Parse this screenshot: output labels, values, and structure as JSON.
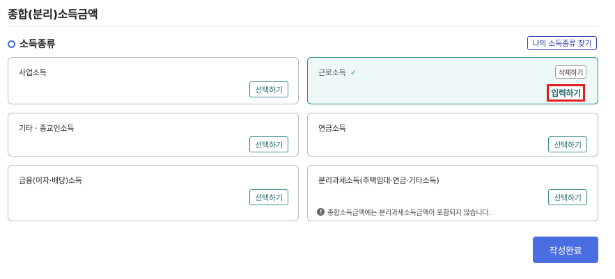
{
  "page_title": "종합(분리)소득금액",
  "section": {
    "title": "소득종류",
    "find_button": "나의 소득종류 찾기"
  },
  "cards": [
    {
      "label": "사업소득",
      "button": "선택하기"
    },
    {
      "label": "근로소득",
      "check": "✓",
      "delete_button": "삭제하기",
      "input_button": "입력하기",
      "selected": true
    },
    {
      "label": "기타 · 종교인소득",
      "button": "선택하기"
    },
    {
      "label": "연금소득",
      "button": "선택하기"
    },
    {
      "label": "금융(이자·배당)소득",
      "button": "선택하기"
    },
    {
      "label": "분리과세소득(주택임대·연금·기타소득)",
      "button": "선택하기",
      "note_icon": "!",
      "note": "종합소득금액에는 분리과세소득금액이 포함되지 않습니다."
    }
  ],
  "submit_button": "작성완료",
  "colors": {
    "accent": "#4a6ee0",
    "teal": "#2a8a8d",
    "highlight": "#e21c1c"
  }
}
